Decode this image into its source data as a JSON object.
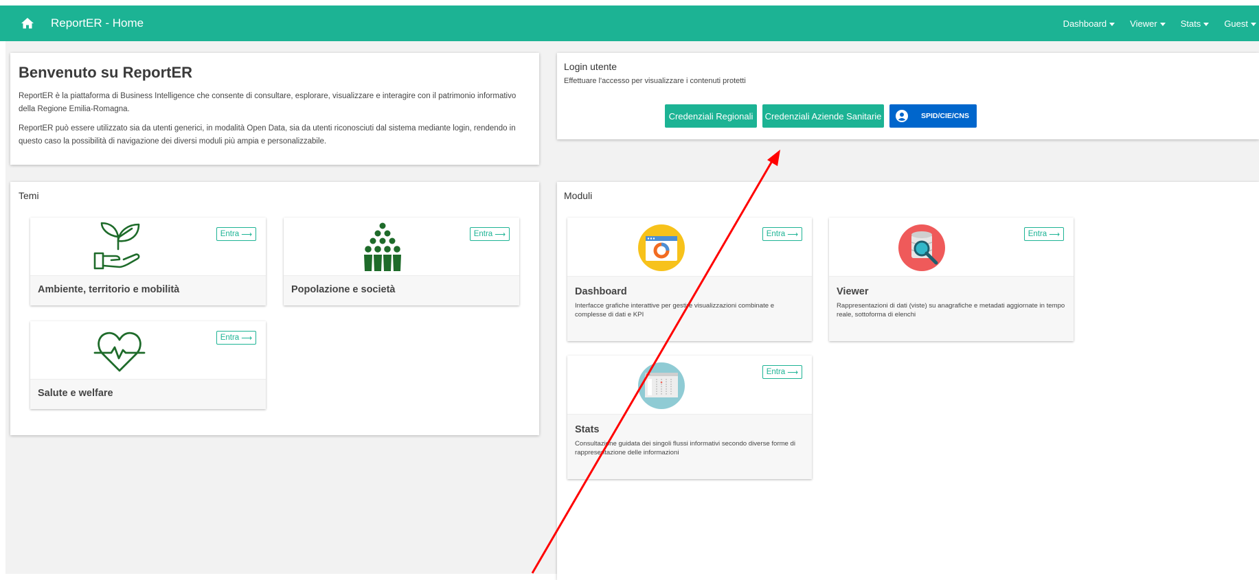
{
  "navbar": {
    "title": "ReportER - Home",
    "menu": [
      {
        "label": "Dashboard"
      },
      {
        "label": "Viewer"
      },
      {
        "label": "Stats"
      },
      {
        "label": "Guest"
      }
    ]
  },
  "welcome": {
    "title": "Benvenuto su ReportER",
    "paragraph1": "ReportER è la piattaforma di Business Intelligence che consente di consultare, esplorare, visualizzare e interagire con il patrimonio informativo della Regione Emilia-Romagna.",
    "paragraph2": "ReportER può essere utilizzato sia da utenti generici, in modalità Open Data, sia da utenti riconosciuti dal sistema mediante login, rendendo in questo caso la possibilità di navigazione dei diversi moduli più ampia e personalizzabile."
  },
  "login": {
    "title": "Login utente",
    "subtitle": "Effettuare l'accesso per visualizzare i contenuti protetti",
    "btn_regionali": "Credenziali Regionali",
    "btn_aziende": "Credenziali Aziende Sanitarie",
    "btn_spid": "SPID/CIE/CNS"
  },
  "temi": {
    "title": "Temi",
    "items": [
      {
        "title": "Ambiente, territorio e mobilità",
        "icon": "plant-hand-icon",
        "enter": "Entra"
      },
      {
        "title": "Popolazione e società",
        "icon": "people-group-icon",
        "enter": "Entra"
      },
      {
        "title": "Salute e welfare",
        "icon": "heart-pulse-icon",
        "enter": "Entra"
      }
    ]
  },
  "moduli": {
    "title": "Moduli",
    "items": [
      {
        "title": "Dashboard",
        "desc": "Interfacce grafiche interattive per gestire visualizzazioni combinate e complesse di dati e KPI",
        "icon": "dashboard-chart-icon",
        "enter": "Entra"
      },
      {
        "title": "Viewer",
        "desc": "Rappresentazioni di dati (viste) su anagrafiche e metadati aggiornate in tempo reale, sottoforma di elenchi",
        "icon": "database-search-icon",
        "enter": "Entra"
      },
      {
        "title": "Stats",
        "desc": "Consultazione guidata dei singoli flussi informativi secondo diverse forme di rappresentazione delle informazioni",
        "icon": "stats-window-icon",
        "enter": "Entra"
      }
    ]
  },
  "colors": {
    "brand_green": "#1cb394",
    "theme_icon_green": "#1e6b2a",
    "spid_blue": "#0066cc",
    "annotation_red": "#ff0000"
  }
}
